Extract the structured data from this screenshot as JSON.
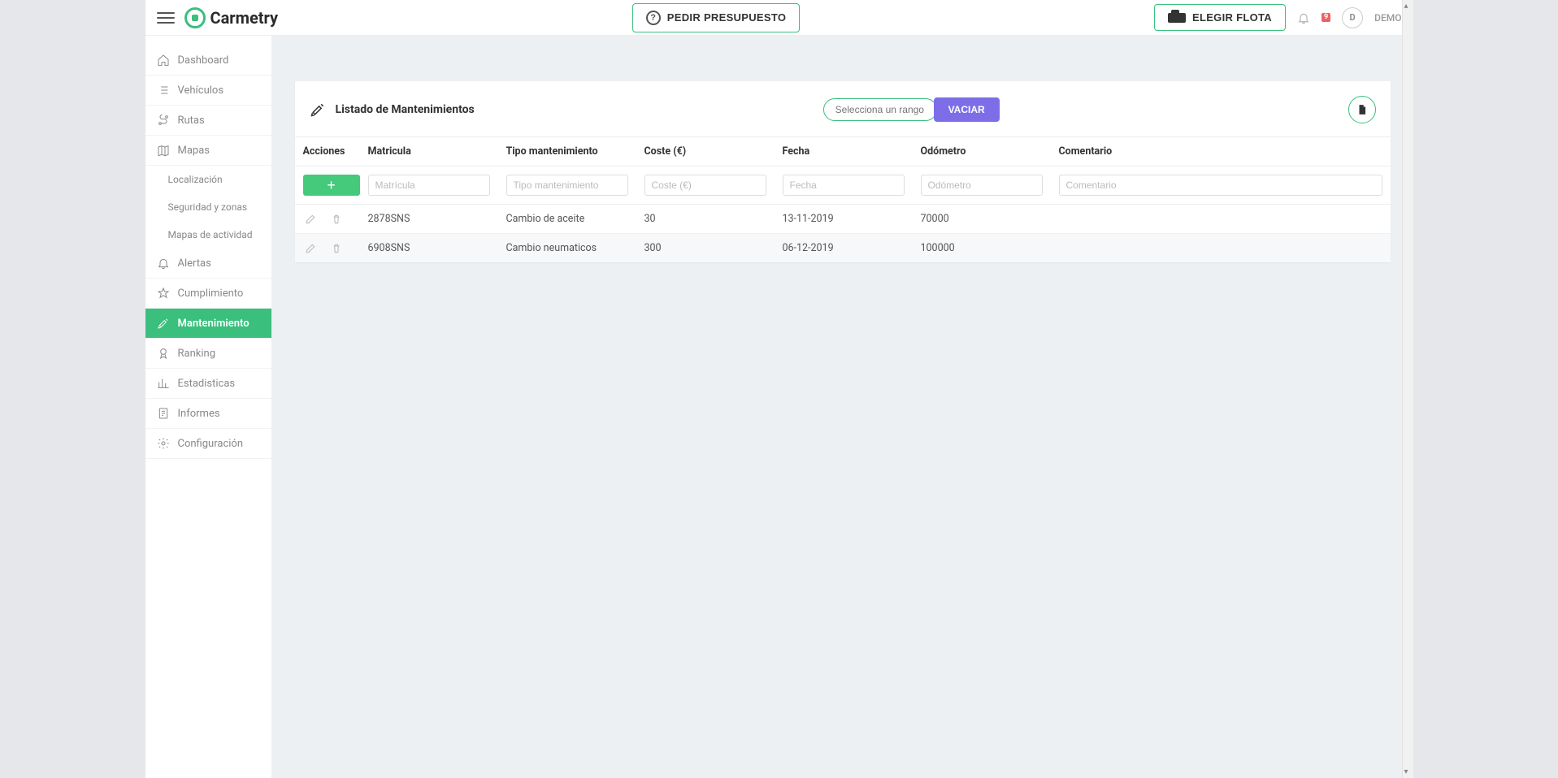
{
  "brand": "Carmetry",
  "topbar": {
    "budget_button": "PEDIR PRESUPUESTO",
    "fleet_button": "ELEGIR FLOTA",
    "notification_badge": "9",
    "avatar_initial": "D",
    "user_label": "DEMO"
  },
  "sidebar": {
    "items": [
      {
        "key": "dashboard",
        "label": "Dashboard",
        "icon": "home"
      },
      {
        "key": "vehiculos",
        "label": "Vehículos",
        "icon": "list"
      },
      {
        "key": "rutas",
        "label": "Rutas",
        "icon": "route"
      },
      {
        "key": "mapas",
        "label": "Mapas",
        "icon": "map"
      },
      {
        "key": "localizacion",
        "label": "Localización",
        "icon": "",
        "sub": true
      },
      {
        "key": "seguridad",
        "label": "Seguridad y zonas",
        "icon": "",
        "sub": true
      },
      {
        "key": "actividad",
        "label": "Mapas de actividad",
        "icon": "",
        "sub": true
      },
      {
        "key": "alertas",
        "label": "Alertas",
        "icon": "bell"
      },
      {
        "key": "cumplimiento",
        "label": "Cumplimiento",
        "icon": "star"
      },
      {
        "key": "mantenimiento",
        "label": "Mantenimiento",
        "icon": "wrench",
        "active": true
      },
      {
        "key": "ranking",
        "label": "Ranking",
        "icon": "medal"
      },
      {
        "key": "estadisticas",
        "label": "Estadisticas",
        "icon": "chart"
      },
      {
        "key": "informes",
        "label": "Informes",
        "icon": "report"
      },
      {
        "key": "configuracion",
        "label": "Configuración",
        "icon": "gear"
      }
    ]
  },
  "panel": {
    "title": "Listado de Mantenimientos",
    "date_placeholder": "Selecciona un rango de ...",
    "clear_button": "VACIAR"
  },
  "table": {
    "headers": {
      "acciones": "Acciones",
      "matricula": "Matricula",
      "tipo": "Tipo mantenimiento",
      "coste": "Coste (€)",
      "fecha": "Fecha",
      "odometro": "Odómetro",
      "comentario": "Comentario"
    },
    "filters": {
      "matricula": "Matrícula",
      "tipo": "Tipo mantenimiento",
      "coste": "Coste (€)",
      "fecha": "Fecha",
      "odometro": "Odómetro",
      "comentario": "Comentario"
    },
    "rows": [
      {
        "matricula": "2878SNS",
        "tipo": "Cambio de aceite",
        "coste": "30",
        "fecha": "13-11-2019",
        "odometro": "70000",
        "comentario": ""
      },
      {
        "matricula": "6908SNS",
        "tipo": "Cambio neumaticos",
        "coste": "300",
        "fecha": "06-12-2019",
        "odometro": "100000",
        "comentario": ""
      }
    ]
  }
}
